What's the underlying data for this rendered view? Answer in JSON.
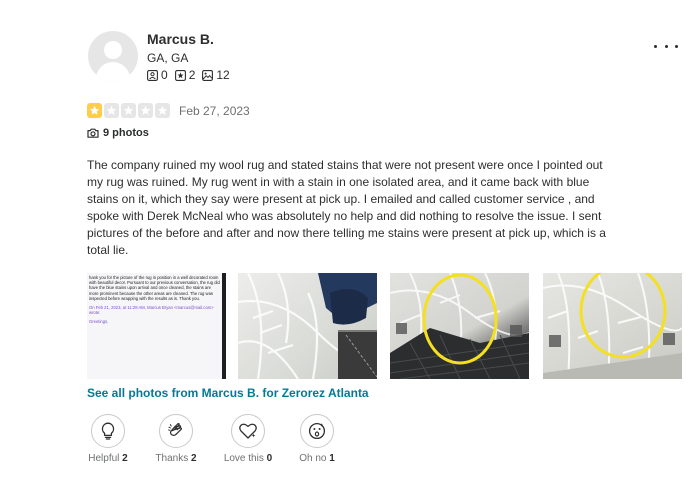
{
  "user": {
    "name": "Marcus B.",
    "location": "GA, GA",
    "friends": "0",
    "reviews": "2",
    "photos": "12"
  },
  "review": {
    "rating": 1,
    "max_rating": 5,
    "date": "Feb 27, 2023",
    "photo_count_label": "9 photos",
    "text": "The company ruined my wool rug and stated stains that were not present were once I pointed out my rug was ruined. My rug went in with a stain in one isolated area, and it came back with blue stains on it, which they say were present at pick up. I emailed and called customer service , and spoke with Derek McNeal who was absolutely no help and did nothing to resolve the issue. I sent pictures of the before and after and now there telling me stains were present at pick up, which is a total lie.",
    "see_all_link": "See all photos from Marcus B. for Zerorez Atlanta"
  },
  "photo1_text": {
    "body": "hank you for the picture of the rug in position in a well decorated room with beautiful decor. Pursuant to our previous conversation, the rug did have the blue stains upon arrival and once cleaned, the stains are more prominent because the other areas are cleaned. The rug was inspected before wrapping with the results as is. Thank you.",
    "quote": "On Feb 21, 2023, at 11:28 AM, Marcus Bryan <marcus@mail.com> wrote:",
    "greeting": "Greetings,"
  },
  "reactions": [
    {
      "label": "Helpful",
      "count": "2",
      "icon": "lightbulb-icon"
    },
    {
      "label": "Thanks",
      "count": "2",
      "icon": "clapping-hands-icon"
    },
    {
      "label": "Love this",
      "count": "0",
      "icon": "heart-icon"
    },
    {
      "label": "Oh no",
      "count": "1",
      "icon": "surprised-face-icon"
    }
  ],
  "colors": {
    "star_on": "#ffcc4b",
    "star_off": "#e6e6e6",
    "link": "#027a97",
    "text": "#2d2e2f",
    "muted": "#6e7072",
    "circle_highlight": "#f4e021"
  }
}
